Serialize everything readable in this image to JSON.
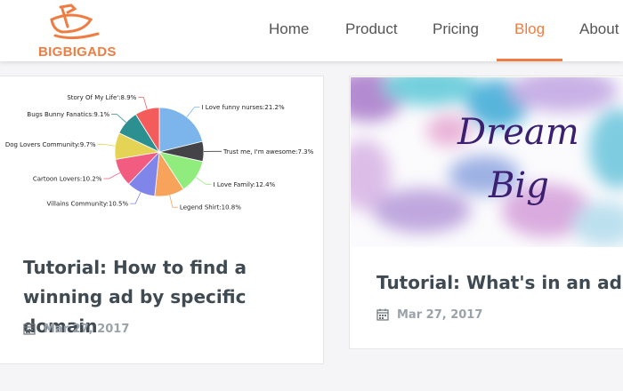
{
  "header": {
    "logo_text": "BIGBIGADS",
    "nav": [
      {
        "label": "Home"
      },
      {
        "label": "Product"
      },
      {
        "label": "Pricing"
      },
      {
        "label": "Blog"
      },
      {
        "label": "About"
      }
    ],
    "active_nav": "Blog",
    "accent_color": "#ef7d43"
  },
  "cards": [
    {
      "title_line1": "Tutorial: How to find a",
      "title_line2": "winning ad by specific domain",
      "date": "Mar 27, 2017",
      "date_icon": "calendar-icon",
      "image": "pie-chart-thumbnail"
    },
    {
      "title": "Tutorial: What's in an ad?",
      "date": "Mar 27, 2017",
      "date_icon": "calendar-icon",
      "image": "dream-big-watercolor",
      "image_text_line1": "Dream",
      "image_text_line2": "Big"
    }
  ],
  "chart_data": {
    "type": "pie",
    "slices": [
      {
        "label": "I Love funny nurses:21.2%",
        "value": 21.2,
        "color": "#7cb5ec"
      },
      {
        "label": "Trust me, I'm awesome:7.3%",
        "value": 7.3,
        "color": "#434348"
      },
      {
        "label": "I Love Family:12.4%",
        "value": 12.4,
        "color": "#90ed7d"
      },
      {
        "label": "Legend Shirt:10.8%",
        "value": 10.8,
        "color": "#f7a35c"
      },
      {
        "label": "Villains Community:10.5%",
        "value": 10.5,
        "color": "#8085e9"
      },
      {
        "label": "Cartoon Lovers:10.2%",
        "value": 10.2,
        "color": "#f15c80"
      },
      {
        "label": "Dog Lovers Community:9.7%",
        "value": 9.7,
        "color": "#e4d354"
      },
      {
        "label": "Bugs Bunny Fanatics:9.1%",
        "value": 9.1,
        "color": "#2b908f"
      },
      {
        "label": "Story Of My Life':8.9%",
        "value": 8.9,
        "color": "#f45b5b"
      }
    ]
  }
}
